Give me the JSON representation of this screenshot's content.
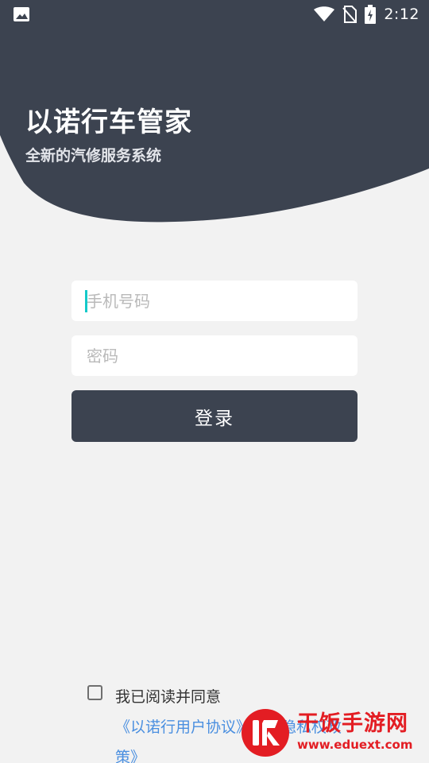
{
  "status_bar": {
    "time": "2:12",
    "icons": [
      "image-icon",
      "wifi-icon",
      "no-sim-icon",
      "battery-icon"
    ]
  },
  "header": {
    "title": "以诺行车管家",
    "subtitle": "全新的汽修服务系统"
  },
  "form": {
    "phone_placeholder": "手机号码",
    "password_placeholder": "密码",
    "login_label": "登录"
  },
  "agreement": {
    "prefix": "我已阅读并同意",
    "user_agreement_link": "《以诺行用户协议》",
    "conjunction": "和",
    "privacy_policy_link": "《隐私权政策》"
  },
  "watermark": {
    "name": "干饭手游网",
    "url": "www.eduext.com"
  },
  "colors": {
    "header_bg": "#3c4350",
    "page_bg": "#f2f2f2",
    "link": "#4a8fe0",
    "caret": "#14c9c9",
    "watermark": "#e31d23"
  }
}
